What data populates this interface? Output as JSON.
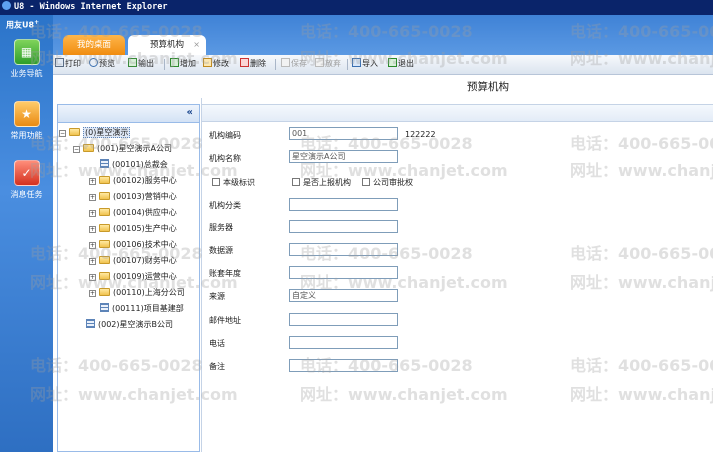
{
  "window": {
    "title": "U8 - Windows Internet Explorer"
  },
  "sidebar": {
    "brand": "用友U8",
    "brand_sup": "+",
    "items": [
      {
        "label": "业务导航",
        "icon": "business-nav-icon"
      },
      {
        "label": "常用功能",
        "icon": "star-icon"
      },
      {
        "label": "消息任务",
        "icon": "task-check-icon"
      }
    ]
  },
  "tabs": [
    {
      "label": "我的桌面"
    },
    {
      "label": "预算机构",
      "close": "×"
    }
  ],
  "toolbar": {
    "print": "打印",
    "preview": "预览",
    "export": "输出",
    "add": "增加",
    "edit": "修改",
    "delete": "删除",
    "save": "保存",
    "cancel": "放弃",
    "import": "导入",
    "exit": "退出"
  },
  "form_title": "预算机构",
  "tree": {
    "collapse": "«",
    "root": "(0)星空演示",
    "company_a": "(001)星空演示A公司",
    "children": [
      "(00101)总裁会",
      "(00102)服务中心",
      "(00103)营销中心",
      "(00104)供应中心",
      "(00105)生产中心",
      "(00106)技术中心",
      "(00107)财务中心",
      "(00109)运营中心",
      "(00110)上海分公司",
      "(00111)项目基建部"
    ],
    "company_b": "(002)星空演示B公司"
  },
  "form": {
    "code_label": "机构编码",
    "code_value": "001",
    "code_note": "122222",
    "name_label": "机构名称",
    "name_value": "星空演示A公司",
    "chk_local": "本级标识",
    "chk_report": "是否上报机构",
    "chk_approve": "公司审批权",
    "category_label": "机构分类",
    "server_label": "服务器",
    "datasource_label": "数据源",
    "year_label": "账套年度",
    "source_label": "来源",
    "source_value": "自定义",
    "email_label": "邮件地址",
    "phone_label": "电话",
    "remark_label": "备注"
  },
  "watermark": {
    "phone": "电话：400-665-0028",
    "site": "网址：www.chanjet.com"
  },
  "colors": {
    "titlebar": "#0a246a",
    "rail": "#3a80d6",
    "tab_active": "#f08c10"
  }
}
